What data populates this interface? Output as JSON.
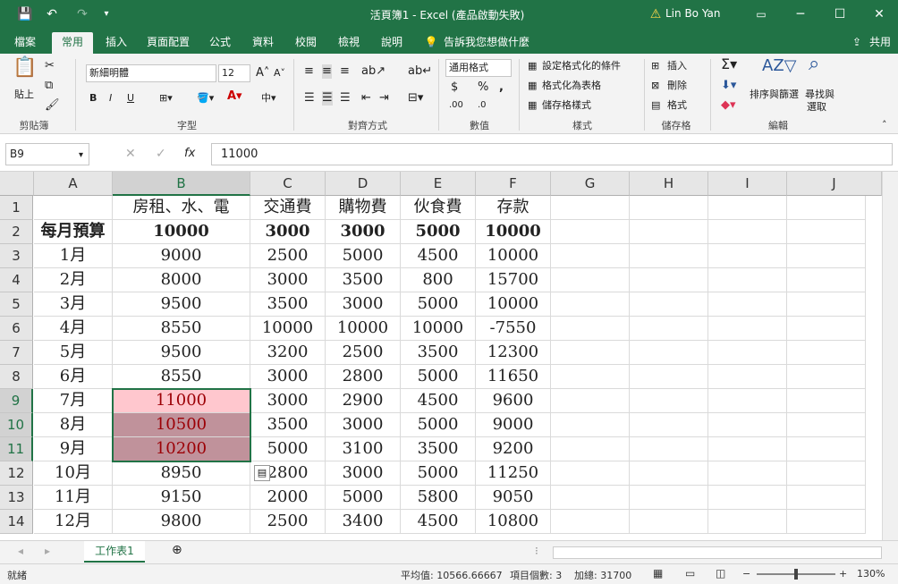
{
  "titlebar": {
    "title": "活頁簿1 - Excel (產品啟動失敗)",
    "user": "Lin Bo Yan",
    "warning_icon": "warning-icon"
  },
  "ribbon_tabs": [
    "檔案",
    "常用",
    "插入",
    "頁面配置",
    "公式",
    "資料",
    "校閱",
    "檢視",
    "說明"
  ],
  "tell_me": "告訴我您想做什麼",
  "share": "共用",
  "ribbon": {
    "clipboard": {
      "paste": "貼上",
      "label": "剪貼簿"
    },
    "font": {
      "name": "新細明體",
      "size": "12",
      "bold": "B",
      "italic": "I",
      "underline": "U",
      "label": "字型"
    },
    "align": {
      "label": "對齊方式"
    },
    "number": {
      "format": "通用格式",
      "label": "數值",
      "currency": "$",
      "percent": "%",
      "comma": ","
    },
    "styles": {
      "cond": "設定格式化的條件",
      "table": "格式化為表格",
      "cell": "儲存格樣式",
      "label": "樣式"
    },
    "cells": {
      "insert": "插入",
      "delete": "刪除",
      "format": "格式",
      "label": "儲存格"
    },
    "editing": {
      "sort": "排序與篩選",
      "find": "尋找與",
      "find2": "選取",
      "label": "編輯"
    }
  },
  "formula": {
    "namebox": "B9",
    "value": "11000"
  },
  "columns": [
    "A",
    "B",
    "C",
    "D",
    "E",
    "F",
    "G",
    "H",
    "I",
    "J"
  ],
  "rows": [
    [
      "",
      "房租、水、電",
      "交通費",
      "購物費",
      "伙食費",
      "存款"
    ],
    [
      "每月預算",
      "10000",
      "3000",
      "3000",
      "5000",
      "10000"
    ],
    [
      "1月",
      "9000",
      "2500",
      "5000",
      "4500",
      "10000"
    ],
    [
      "2月",
      "8000",
      "3000",
      "3500",
      "800",
      "15700"
    ],
    [
      "3月",
      "9500",
      "3500",
      "3000",
      "5000",
      "10000"
    ],
    [
      "4月",
      "8550",
      "10000",
      "10000",
      "10000",
      "-7550"
    ],
    [
      "5月",
      "9500",
      "3200",
      "2500",
      "3500",
      "12300"
    ],
    [
      "6月",
      "8550",
      "3000",
      "2800",
      "5000",
      "11650"
    ],
    [
      "7月",
      "11000",
      "3000",
      "2900",
      "4500",
      "9600"
    ],
    [
      "8月",
      "10500",
      "3500",
      "3000",
      "5000",
      "9000"
    ],
    [
      "9月",
      "10200",
      "5000",
      "3100",
      "3500",
      "9200"
    ],
    [
      "10月",
      "8950",
      "2800",
      "3000",
      "5000",
      "11250"
    ],
    [
      "11月",
      "9150",
      "2000",
      "5000",
      "5800",
      "9050"
    ],
    [
      "12月",
      "9800",
      "2500",
      "3400",
      "4500",
      "10800"
    ]
  ],
  "sheet": {
    "tab": "工作表1"
  },
  "status": {
    "ready": "就緒",
    "average": "平均值: 10566.66667",
    "count": "項目個數: 3",
    "sum": "加總: 31700",
    "zoom": "130%"
  }
}
